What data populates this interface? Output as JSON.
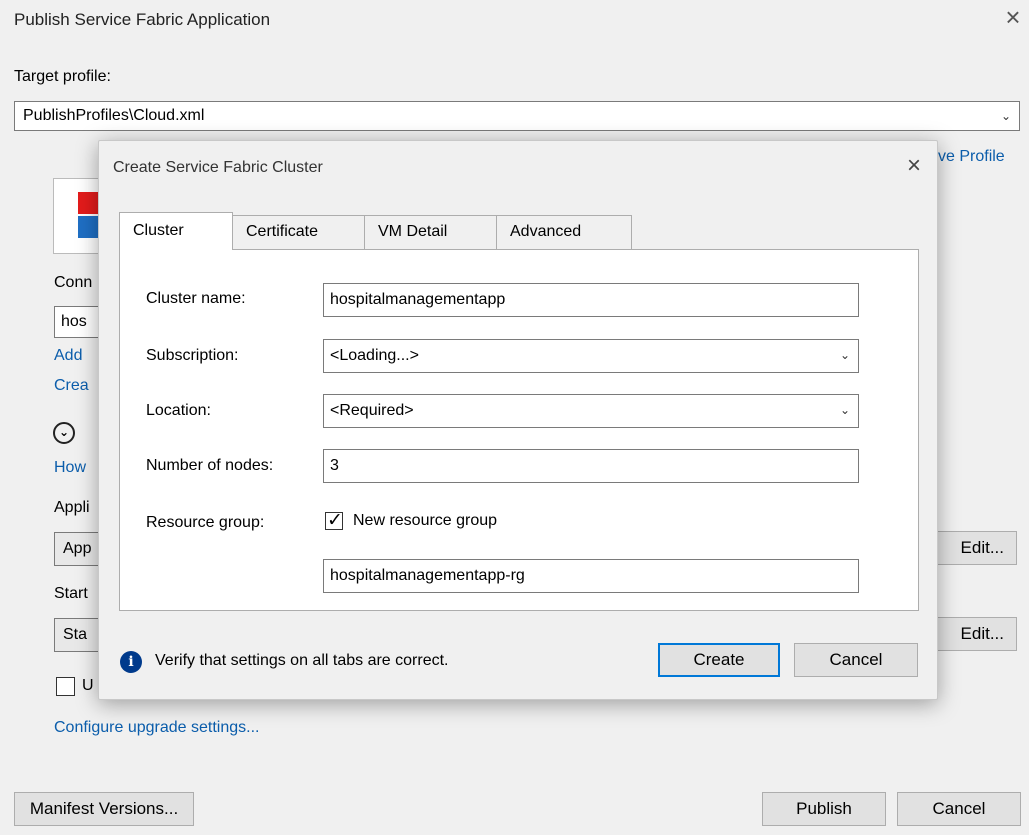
{
  "window": {
    "title": "Publish Service Fabric Application",
    "close_icon": "close-icon"
  },
  "target_profile": {
    "label": "Target profile:",
    "value": "PublishProfiles\\Cloud.xml"
  },
  "partial_labels": {
    "save_profile": "ve Profile",
    "connection": "Conn",
    "endpoint_value": "hos",
    "add_link": "Add",
    "create_link": "Crea",
    "how_link": "How",
    "application": "Appli",
    "application_value": "App",
    "start": "Start",
    "start_value": "Sta",
    "upgrade_check": "U"
  },
  "edit_buttons": [
    "Edit...",
    "Edit..."
  ],
  "configure_upgrade_link": "Configure upgrade settings...",
  "footer": {
    "manifest_versions": "Manifest Versions...",
    "publish": "Publish",
    "cancel": "Cancel"
  },
  "dialog": {
    "title": "Create Service Fabric Cluster",
    "tabs": [
      "Cluster",
      "Certificate",
      "VM Detail",
      "Advanced"
    ],
    "active_tab": "Cluster",
    "fields": {
      "cluster_name": {
        "label": "Cluster name:",
        "value": "hospitalmanagementapp"
      },
      "subscription": {
        "label": "Subscription:",
        "value": "<Loading...>"
      },
      "location": {
        "label": "Location:",
        "value": "<Required>"
      },
      "nodes": {
        "label": "Number of nodes:",
        "value": "3"
      },
      "resource_group": {
        "label": "Resource group:",
        "checkbox_label": "New resource group",
        "checked": true,
        "value": "hospitalmanagementapp-rg"
      }
    },
    "info_text": "Verify that settings on all tabs are correct.",
    "create_button": "Create",
    "cancel_button": "Cancel"
  },
  "colors": {
    "background": "#f0f0f0",
    "link": "#0b5dab",
    "accent": "#0078d7",
    "info_icon": "#003a8c"
  }
}
